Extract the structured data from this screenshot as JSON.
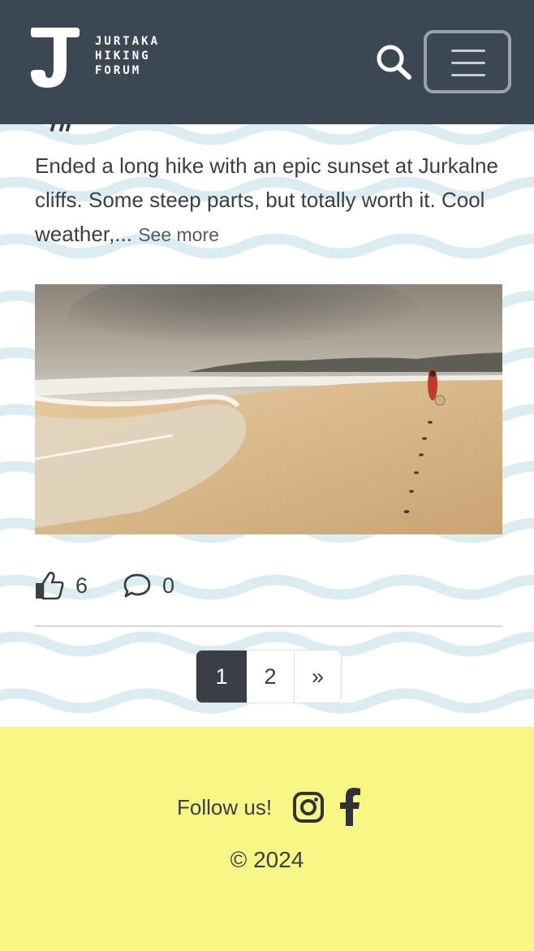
{
  "brand": {
    "letter": "J",
    "name_lines": [
      "JURTAKA",
      "HIKING",
      "FORUM"
    ]
  },
  "header": {
    "search_icon": "search-icon",
    "menu_icon": "hamburger-icon"
  },
  "post": {
    "body": "Ended a long hike with an epic sunset at Jurkalne cliffs. Some steep parts, but totally worth it. Cool weather,...",
    "see_more": "See more",
    "likes": "6",
    "comments": "0"
  },
  "pagination": {
    "pages": [
      "1",
      "2"
    ],
    "next": "»",
    "active": "1"
  },
  "footer": {
    "follow_label": "Follow us!",
    "copyright_symbol": "©",
    "year": "2024"
  },
  "colors": {
    "header_bg": "#3c4754",
    "footer_bg": "#f8f684",
    "wave": "#dcedf2",
    "text": "#3a3f45"
  }
}
